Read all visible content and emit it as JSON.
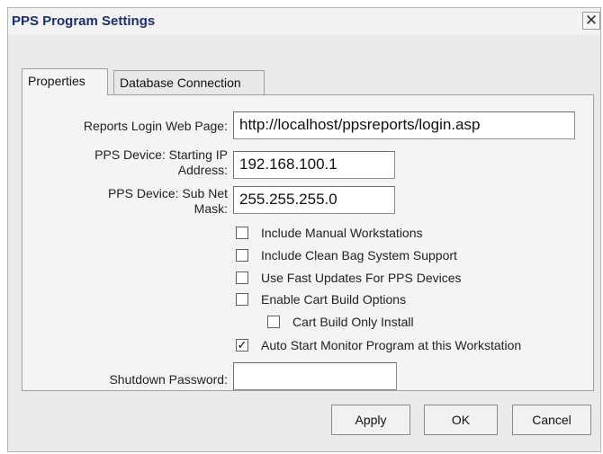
{
  "window": {
    "title": "PPS Program Settings",
    "close_glyph": "✕"
  },
  "tabs": [
    {
      "label": "Properties",
      "active": true
    },
    {
      "label": "Database Connection",
      "active": false
    }
  ],
  "form": {
    "reports_login": {
      "label": "Reports Login Web Page:",
      "value": "http://localhost/ppsreports/login.asp"
    },
    "starting_ip": {
      "label_line1": "PPS Device:  Starting IP",
      "label_line2": "Address:",
      "value": "192.168.100.1"
    },
    "subnet_mask": {
      "label_line1": "PPS Device:  Sub Net",
      "label_line2": "Mask:",
      "value": "255.255.255.0"
    },
    "shutdown_password": {
      "label": "Shutdown Password:",
      "value": ""
    }
  },
  "checkboxes": [
    {
      "label": "Include Manual Workstations",
      "checked": false
    },
    {
      "label": "Include Clean Bag System Support",
      "checked": false
    },
    {
      "label": "Use Fast Updates For PPS Devices",
      "checked": false
    },
    {
      "label": "Enable Cart Build Options",
      "checked": false
    },
    {
      "label": "Cart Build Only Install",
      "checked": false
    },
    {
      "label": "Auto Start Monitor Program at this Workstation",
      "checked": true
    }
  ],
  "buttons": {
    "apply": "Apply",
    "ok": "OK",
    "cancel": "Cancel"
  },
  "colors": {
    "title_text": "#1d2f6f",
    "dialog_bg": "#eaeaea",
    "panel_bg": "#f4f4f4"
  },
  "icons": {
    "close": "close-icon",
    "check": "check-mark-icon"
  }
}
